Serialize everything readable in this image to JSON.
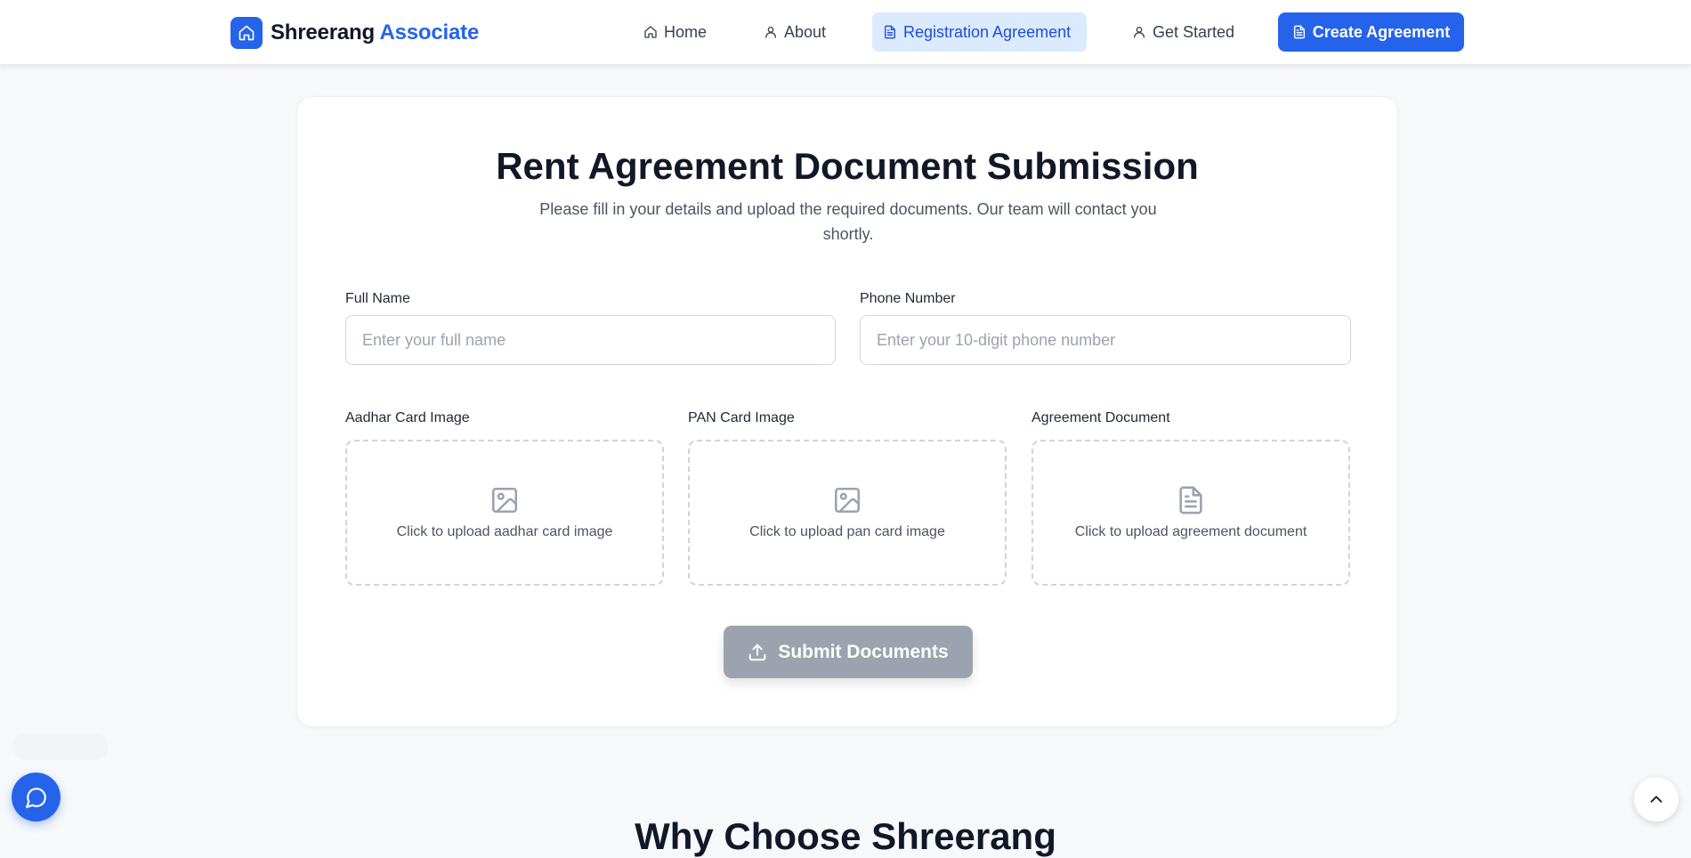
{
  "brand": {
    "name_primary": "Shreerang",
    "name_accent": "Associate",
    "logo_icon": "home-icon",
    "accent_color": "#2563eb"
  },
  "nav": {
    "items": [
      {
        "label": "Home",
        "icon": "home-icon",
        "active": false
      },
      {
        "label": "About",
        "icon": "user-icon",
        "active": false
      },
      {
        "label": "Registration Agreement",
        "icon": "document-icon",
        "active": true
      },
      {
        "label": "Get Started",
        "icon": "user-icon",
        "active": false
      }
    ],
    "cta_label": "Create Agreement",
    "cta_icon": "document-icon"
  },
  "form": {
    "title": "Rent Agreement Document Submission",
    "subtitle": "Please fill in your details and upload the required documents. Our team will contact you shortly.",
    "full_name": {
      "label": "Full Name",
      "placeholder": "Enter your full name",
      "value": ""
    },
    "phone": {
      "label": "Phone Number",
      "placeholder": "Enter your 10-digit phone number",
      "value": ""
    },
    "uploads": [
      {
        "label": "Aadhar Card Image",
        "text": "Click to upload aadhar card image",
        "icon": "image-icon"
      },
      {
        "label": "PAN Card Image",
        "text": "Click to upload pan card image",
        "icon": "image-icon"
      },
      {
        "label": "Agreement Document",
        "text": "Click to upload agreement document",
        "icon": "file-text-icon"
      }
    ],
    "submit_label": "Submit Documents",
    "submit_icon": "upload-icon",
    "submit_color": "#9ca3af"
  },
  "floating": {
    "chat_icon": "chat-icon",
    "scroll_top_icon": "chevron-up-icon"
  },
  "next_section": {
    "title": "Why Choose Shreerang"
  }
}
